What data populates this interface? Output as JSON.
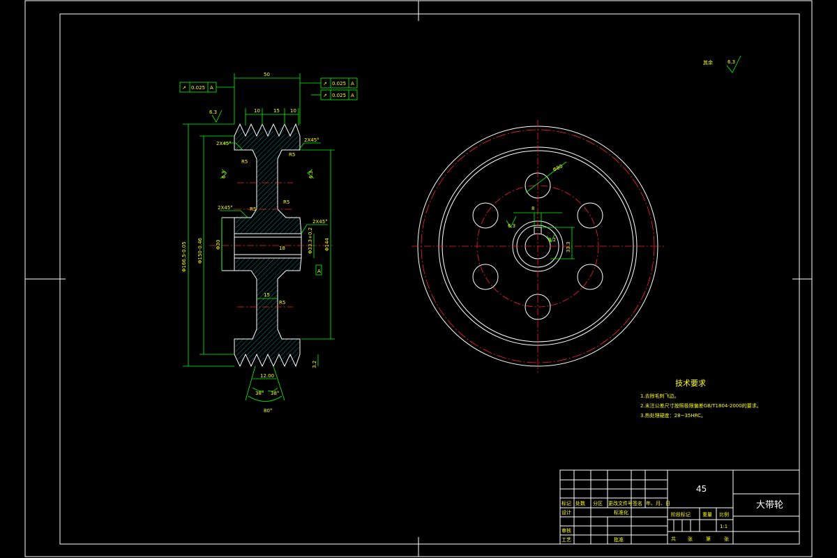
{
  "drawing": {
    "dims": {
      "width_top": "50",
      "groove_1": "10",
      "groove_2": "15",
      "groove_3": "10",
      "dia_outer": "Φ166.5-0.05",
      "dia_mid": "Φ150-0.46",
      "dia_bore": "Φ30",
      "dia_hub_r1": "Φ33.3+0.2",
      "dia_hub_r2": "Φ144",
      "web_width": "15",
      "chamfer_tr": "2X45°",
      "chamfer_tl": "2X45°",
      "chamfer_ml": "2X45°",
      "chamfer_mr": "2X45°",
      "groove_top": "12.00",
      "groove_angle": "38°",
      "bottom_angle": "80°",
      "rough_63": "6.3",
      "rough_32": "3.2",
      "r_b": "R5",
      "r_bb": "R5",
      "slot": "18",
      "hole_pcd": "Φ40",
      "hole_dia": "Φ80",
      "key_width": "8",
      "key_depth": "33.3",
      "tol1": "0.025",
      "tol1_sym": "↗",
      "tol1_ref": "A",
      "tol2": "0.025",
      "tol3": "0.025",
      "datum": "A",
      "side_dia": "Φ10",
      "rough_top": "6.3",
      "other_label": "其余"
    },
    "tech": {
      "title": "技术要求",
      "items": [
        "1.去除毛刺飞边。",
        "2.未注公差尺寸按照极限偏差GB/T1804-2000的要求。",
        "3.热处理硬度：28~35HRC。"
      ]
    },
    "title_block": {
      "material": "45",
      "part_name": "大带轮",
      "scale_label": "比例",
      "scale": "1:1",
      "weight_label": "重量",
      "stage_label": "阶段标记",
      "labels_row": [
        "标记",
        "处数",
        "分区",
        "更改文件号",
        "签名",
        "年、月、日"
      ],
      "design": "设计",
      "standard": "标准化",
      "review": "审核",
      "process": "工艺",
      "approve": "批准",
      "sheet": [
        "共",
        "张",
        "第",
        "张"
      ]
    }
  }
}
